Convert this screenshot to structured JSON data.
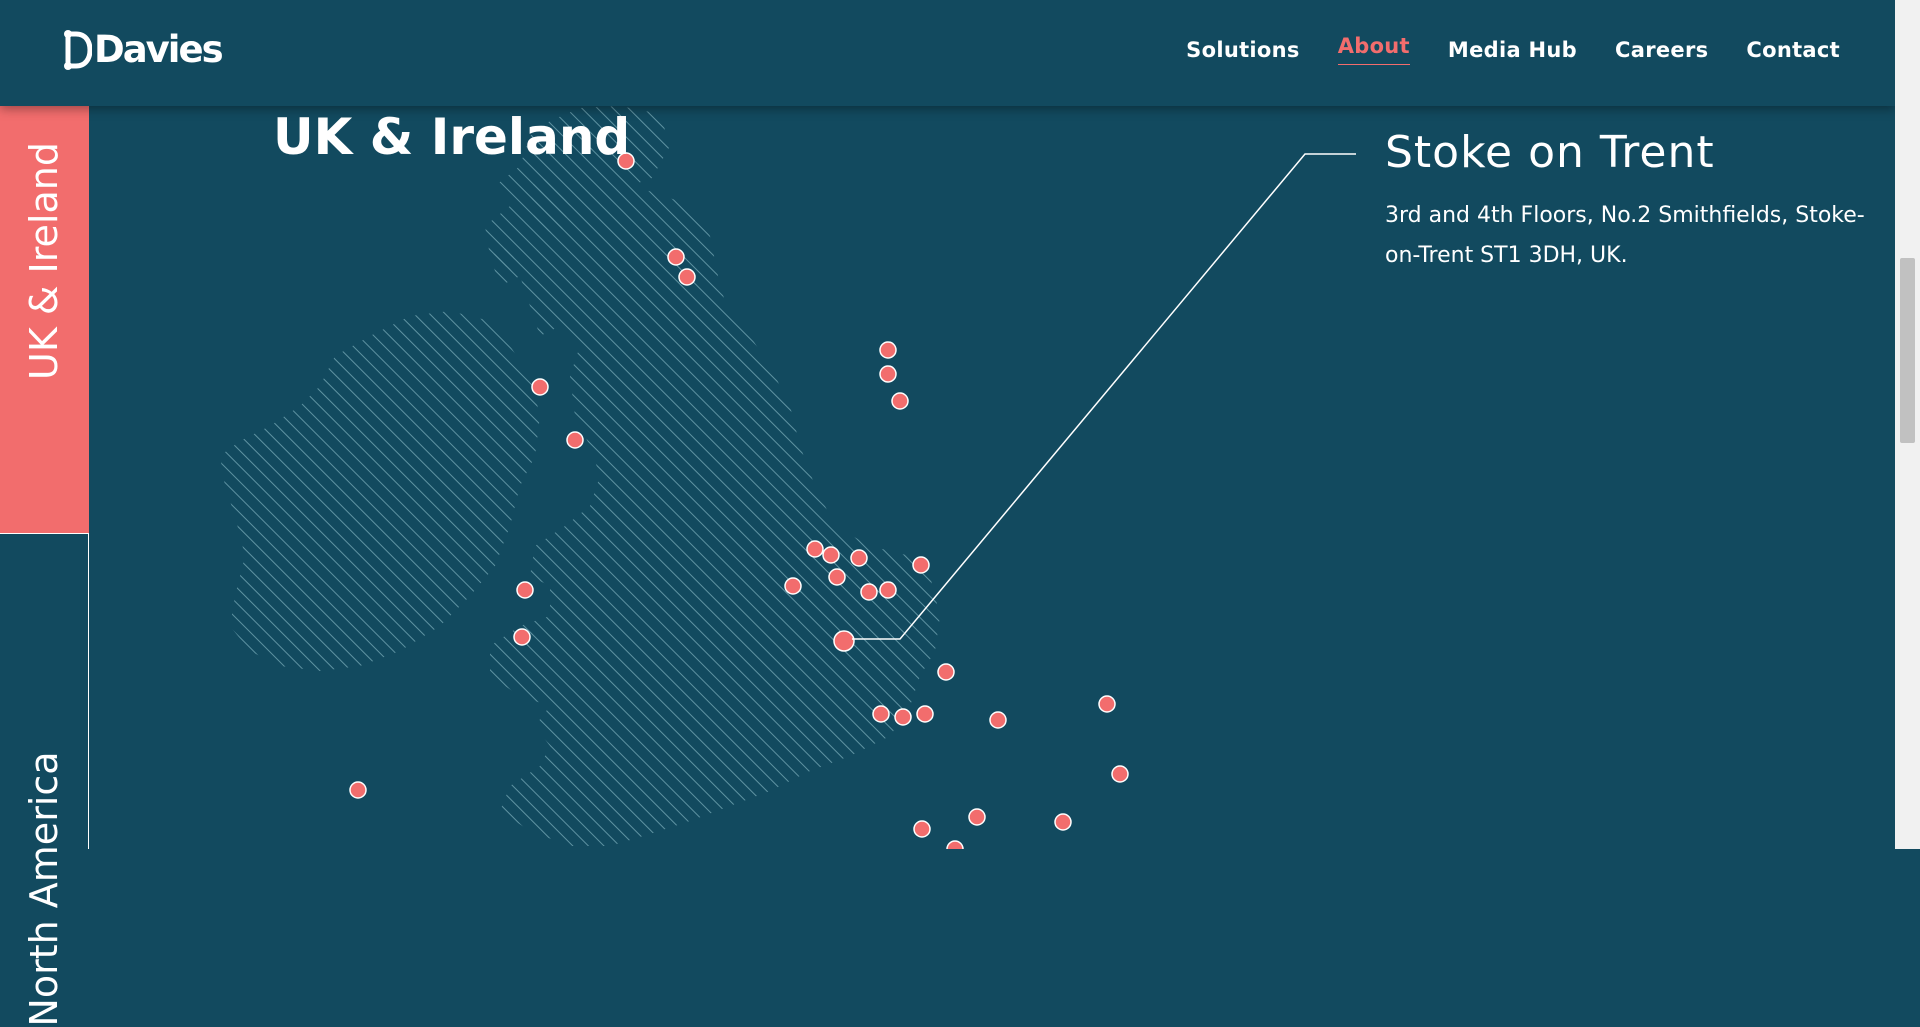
{
  "brand": {
    "name": "Davies"
  },
  "nav": {
    "items": [
      {
        "label": "Solutions",
        "active": false
      },
      {
        "label": "About",
        "active": true
      },
      {
        "label": "Media Hub",
        "active": false
      },
      {
        "label": "Careers",
        "active": false
      },
      {
        "label": "Contact",
        "active": false
      }
    ]
  },
  "sidebar": {
    "tabs": [
      {
        "label": "UK & Ireland",
        "active": true
      },
      {
        "label": "North America",
        "active": false
      }
    ]
  },
  "region": {
    "title": "UK & Ireland"
  },
  "selected_office": {
    "name": "Stoke on Trent",
    "address": "3rd and 4th Floors, No.2 Smithfields, Stoke-on-Trent ST1 3DH, UK."
  },
  "colors": {
    "background": "#124a5f",
    "accent": "#f26d6d",
    "text": "#ffffff"
  }
}
